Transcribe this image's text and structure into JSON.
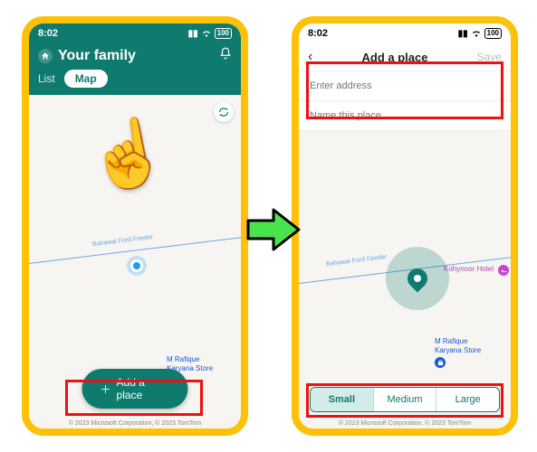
{
  "status": {
    "time": "8:02",
    "battery": "100"
  },
  "left": {
    "title": "Your family",
    "tab_list": "List",
    "tab_map": "Map",
    "add_place": "Add a place",
    "road_label": "Bahawal Ford Feeder",
    "poi_store_line1": "M Rafique",
    "poi_store_line2": "Karyana Store",
    "attribution": "© 2023 Microsoft Corporation, © 2023 TomTom"
  },
  "right": {
    "title": "Add a place",
    "save": "Save",
    "input_address": "Enter address",
    "input_name": "Name this place",
    "road_label": "Bahawal Ford Feeder",
    "poi_store_line1": "M Rafique",
    "poi_store_line2": "Karyana Store",
    "poi_hotel": "Kohynoor Hotel",
    "seg_small": "Small",
    "seg_medium": "Medium",
    "seg_large": "Large",
    "attribution": "© 2023 Microsoft Corporation, © 2023 TomTom"
  }
}
